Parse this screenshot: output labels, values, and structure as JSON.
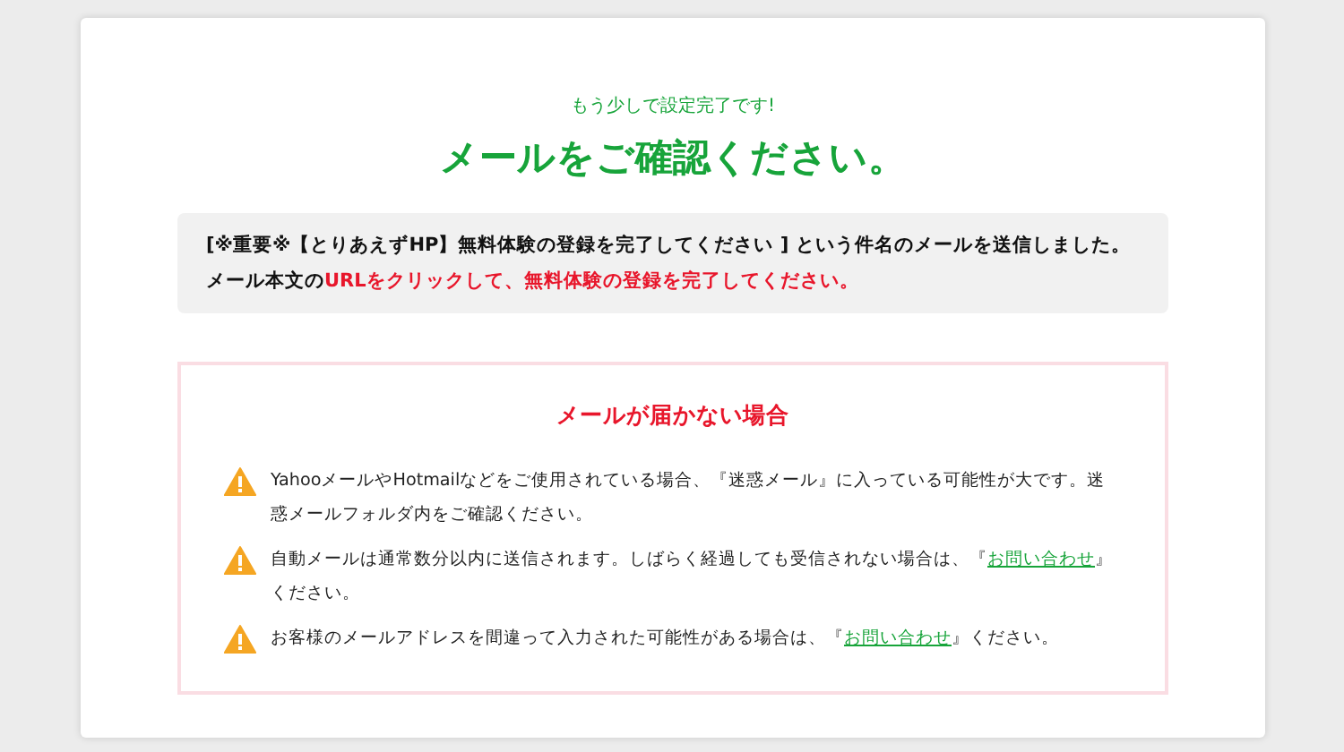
{
  "subtitle": "もう少しで設定完了です!",
  "title": "メールをご確認ください。",
  "info": {
    "lines": [
      [
        {
          "kind": "plain",
          "text": "[※重要※【とりあえずHP】無料体験の登録を完了してください ] という件名のメールを送信しました。"
        }
      ],
      [
        {
          "kind": "plain",
          "text": "メール本文の"
        },
        {
          "kind": "alert",
          "text": "URLをクリックして、無料体験の登録を完了してください。"
        }
      ]
    ]
  },
  "notice": {
    "heading": "メールが届かない場合",
    "items": [
      {
        "parts": [
          {
            "kind": "text",
            "text": "YahooメールやHotmailなどをご使用されている場合、『迷惑メール』に入っている可能性が大です。迷惑メールフォルダ内をご確認ください。"
          }
        ]
      },
      {
        "parts": [
          {
            "kind": "text",
            "text": "自動メールは通常数分以内に送信されます。しばらく経過しても受信されない場合は、『"
          },
          {
            "kind": "link",
            "text": "お問い合わせ"
          },
          {
            "kind": "text",
            "text": "』ください。"
          }
        ]
      },
      {
        "parts": [
          {
            "kind": "text",
            "text": "お客様のメールアドレスを間違って入力された可能性がある場合は、『"
          },
          {
            "kind": "link",
            "text": "お問い合わせ"
          },
          {
            "kind": "text",
            "text": "』ください。"
          }
        ]
      }
    ]
  }
}
